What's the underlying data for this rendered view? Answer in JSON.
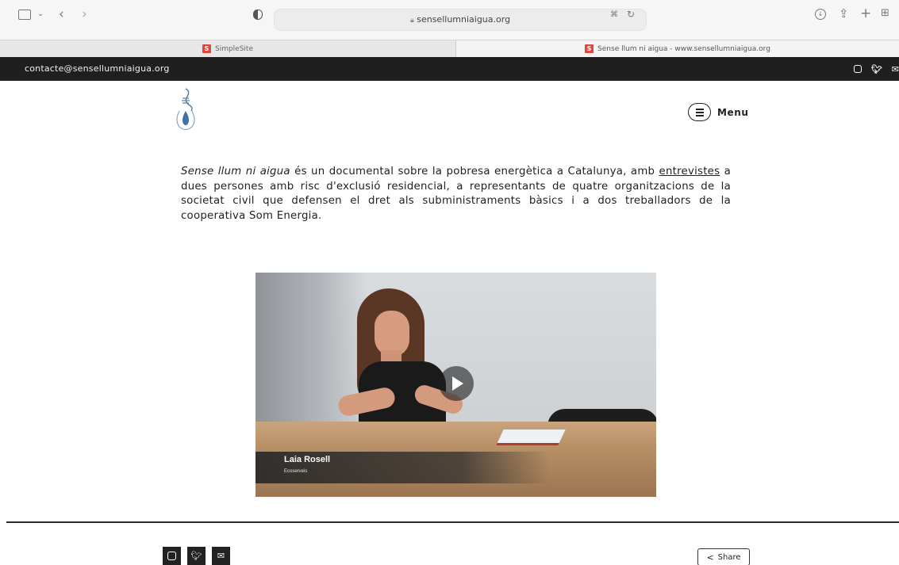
{
  "browser": {
    "url": "sensellumniaigua.org",
    "tabs": [
      {
        "favicon": "S",
        "title": "SimpleSite",
        "active": false
      },
      {
        "favicon": "S",
        "title": "Sense llum ni aigua - www.sensellumniaigua.org",
        "active": true
      }
    ],
    "icons": [
      "sidebar-icon",
      "chevron-down-icon",
      "back-icon",
      "forward-icon",
      "shield-icon",
      "lock-icon",
      "translate-icon",
      "reload-icon",
      "download-icon",
      "share-icon",
      "new-tab-icon",
      "tab-overview-icon"
    ]
  },
  "topbar": {
    "email": "contacte@sensellumniaigua.org",
    "social": [
      "instagram-icon",
      "twitter-icon",
      "mail-icon"
    ]
  },
  "header": {
    "menu_label": "Menu"
  },
  "intro": {
    "title_italic": "Sense llum ni aigua",
    "text_before_link": " és un documental sobre la pobresa energètica a Catalunya, amb ",
    "link_text": "entrevistes",
    "text_after_link": " a dues persones amb risc d'exclusió residencial, a representants de quatre organitzacions de la societat civil que defensen el dret als subministraments bàsics i a dos treballadors de la cooperativa Som Energia."
  },
  "video": {
    "name": "Laia Rosell",
    "organization": "Ecoserveis"
  },
  "footer": {
    "social": [
      "instagram-icon",
      "twitter-icon",
      "mail-icon"
    ],
    "share_label": "Share"
  }
}
